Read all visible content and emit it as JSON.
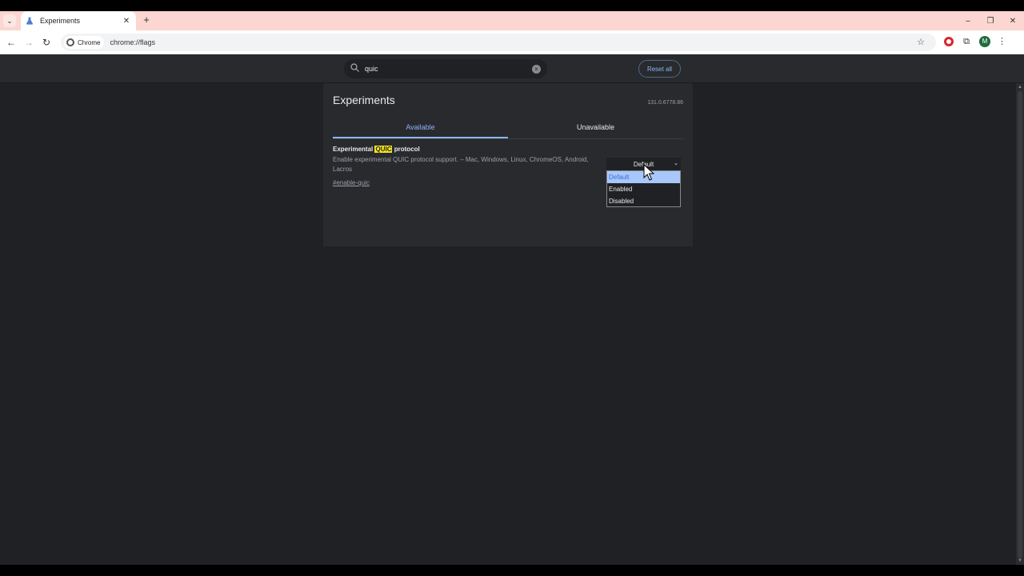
{
  "browser": {
    "tab_title": "Experiments",
    "tab_close": "✕",
    "new_tab": "+",
    "chip_label": "Chrome",
    "url": "chrome://flags",
    "avatar_letter": "M",
    "win_minimize": "–",
    "win_restore": "❐",
    "win_close": "✕"
  },
  "header": {
    "search_value": "quic",
    "reset_label": "Reset all"
  },
  "content": {
    "title": "Experiments",
    "version": "131.0.6778.86",
    "tabs": [
      {
        "label": "Available"
      },
      {
        "label": "Unavailable"
      }
    ]
  },
  "flag": {
    "name_prefix": "Experimental ",
    "name_highlight": "QUIC",
    "name_suffix": " protocol",
    "description": "Enable experimental QUIC protocol support. – Mac, Windows, Linux, ChromeOS, Android, Lacros",
    "link": "#enable-quic",
    "selected_value": "Default",
    "options": [
      "Default",
      "Enabled",
      "Disabled"
    ]
  },
  "colors": {
    "accent": "#8ab4f8",
    "highlight": "#f6e71b",
    "page_bg": "#202124",
    "tabstrip_bg": "#fcd6d0"
  }
}
